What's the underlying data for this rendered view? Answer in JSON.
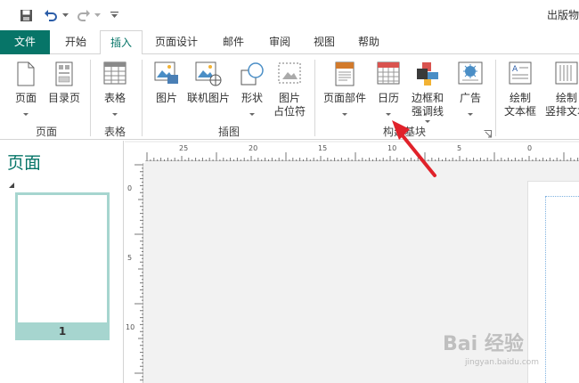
{
  "title_bar": {
    "doc_title": "出版物"
  },
  "tabs": [
    "文件",
    "开始",
    "插入",
    "页面设计",
    "邮件",
    "审阅",
    "视图",
    "帮助"
  ],
  "ribbon": {
    "page": "页面",
    "catalog_page": "目录页",
    "table": "表格",
    "picture": "图片",
    "online_picture": "联机图片",
    "shapes": "形状",
    "picture_placeholder_1": "图片",
    "picture_placeholder_2": "占位符",
    "page_parts": "页面部件",
    "calendar": "日历",
    "borders_1": "边框和",
    "borders_2": "强调线",
    "advertisement": "广告",
    "draw_textbox_1": "绘制",
    "draw_textbox_2": "文本框",
    "draw_vertical_1": "绘制",
    "draw_vertical_2": "竖排文本",
    "groups": {
      "pages": "页面",
      "tables": "表格",
      "illustrations": "插图",
      "building_blocks": "构建基块"
    }
  },
  "pages_pane": {
    "title": "页面",
    "page_number": "1"
  },
  "ruler": {
    "h_labels": [
      "25",
      "20",
      "15",
      "10",
      "5",
      "0"
    ],
    "v_labels": [
      "0",
      "5",
      "10"
    ]
  },
  "watermark": {
    "main": "Bai 经验",
    "sub": "jingyan.baidu.com"
  },
  "colors": {
    "accent": "#077568",
    "arrow": "#e0222a"
  }
}
